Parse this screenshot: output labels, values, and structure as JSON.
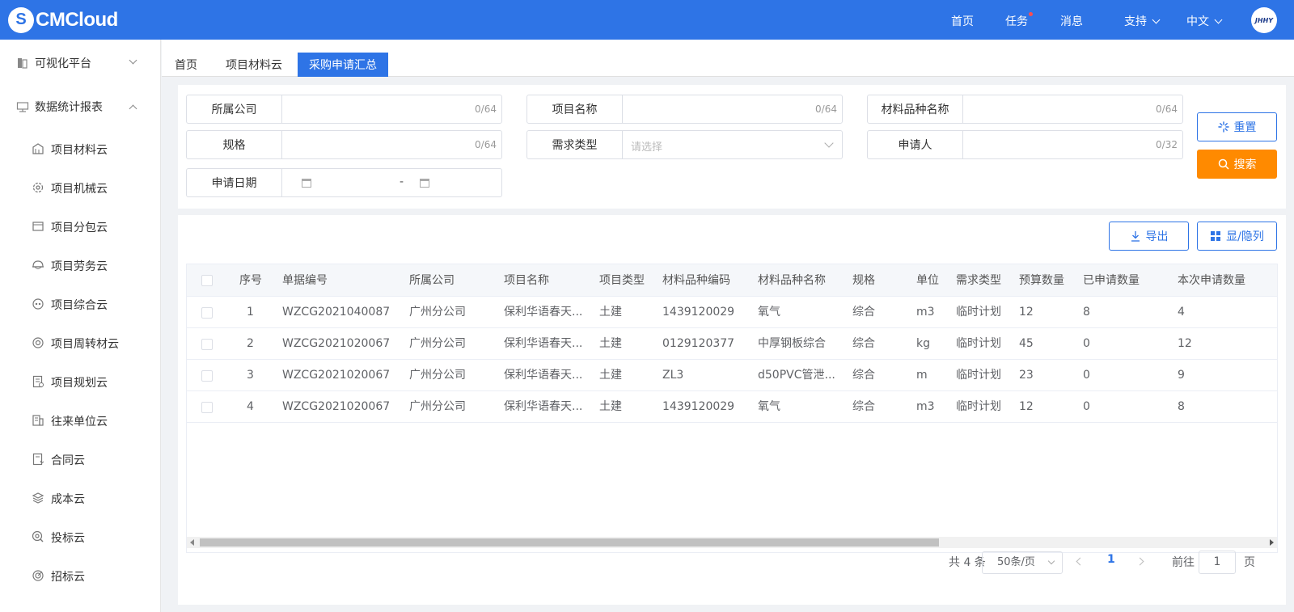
{
  "header": {
    "logo_text": "CMCloud",
    "nav": [
      "首页",
      "任务",
      "消息"
    ],
    "support_label": "支持",
    "language_label": "中文",
    "avatar_text": "JHHY"
  },
  "sidebar": {
    "groups": [
      {
        "label": "可视化平台",
        "icon": "dashboard-icon",
        "expanded": false
      },
      {
        "label": "数据统计报表",
        "icon": "report-icon",
        "expanded": true
      }
    ],
    "items": [
      {
        "label": "项目材料云",
        "icon": "material-icon"
      },
      {
        "label": "项目机械云",
        "icon": "gear-icon"
      },
      {
        "label": "项目分包云",
        "icon": "subcontract-icon"
      },
      {
        "label": "项目劳务云",
        "icon": "helmet-icon"
      },
      {
        "label": "项目综合云",
        "icon": "cloud-icon"
      },
      {
        "label": "项目周转材云",
        "icon": "cycle-icon"
      },
      {
        "label": "项目规划云",
        "icon": "plan-icon"
      },
      {
        "label": "往来单位云",
        "icon": "building-icon"
      },
      {
        "label": "合同云",
        "icon": "contract-icon"
      },
      {
        "label": "成本云",
        "icon": "layers-icon"
      },
      {
        "label": "投标云",
        "icon": "bid-icon"
      },
      {
        "label": "招标云",
        "icon": "tender-icon"
      }
    ]
  },
  "tabs": [
    {
      "label": "首页",
      "active": false
    },
    {
      "label": "项目材料云",
      "active": false
    },
    {
      "label": "采购申请汇总",
      "active": true
    }
  ],
  "filters": {
    "company": {
      "label": "所属公司",
      "count": "0/64"
    },
    "project_name": {
      "label": "项目名称",
      "count": "0/64"
    },
    "material_name": {
      "label": "材料品种名称",
      "count": "0/64"
    },
    "spec": {
      "label": "规格",
      "count": "0/64"
    },
    "demand_type": {
      "label": "需求类型",
      "placeholder": "请选择"
    },
    "applicant": {
      "label": "申请人",
      "count": "0/32"
    },
    "apply_date": {
      "label": "申请日期",
      "separator": "-"
    }
  },
  "actions": {
    "reset": "重置",
    "search": "搜索",
    "export": "导出",
    "columns": "显/隐列"
  },
  "table": {
    "columns": [
      "序号",
      "单据编号",
      "所属公司",
      "项目名称",
      "项目类型",
      "材料品种编码",
      "材料品种名称",
      "规格",
      "单位",
      "需求类型",
      "预算数量",
      "已申请数量",
      "本次申请数量"
    ],
    "rows": [
      [
        "1",
        "WZCG2021040087",
        "广州分公司",
        "保利华语春天...",
        "土建",
        "1439120029",
        "氧气",
        "综合",
        "m3",
        "临时计划",
        "12",
        "8",
        "4"
      ],
      [
        "2",
        "WZCG2021020067",
        "广州分公司",
        "保利华语春天...",
        "土建",
        "0129120377",
        "中厚钢板综合",
        "综合",
        "kg",
        "临时计划",
        "45",
        "0",
        "12"
      ],
      [
        "3",
        "WZCG2021020067",
        "广州分公司",
        "保利华语春天...",
        "土建",
        "ZL3",
        "d50PVC管泄...",
        "综合",
        "m",
        "临时计划",
        "23",
        "0",
        "9"
      ],
      [
        "4",
        "WZCG2021020067",
        "广州分公司",
        "保利华语春天...",
        "土建",
        "1439120029",
        "氧气",
        "综合",
        "m3",
        "临时计划",
        "12",
        "0",
        "8"
      ]
    ]
  },
  "pagination": {
    "total_text": "共 4 条",
    "page_size": "50条/页",
    "current_page": "1",
    "goto_label": "前往",
    "goto_value": "1",
    "page_suffix": "页"
  },
  "colors": {
    "primary": "#2e74e6",
    "accent": "#ff8a00"
  }
}
